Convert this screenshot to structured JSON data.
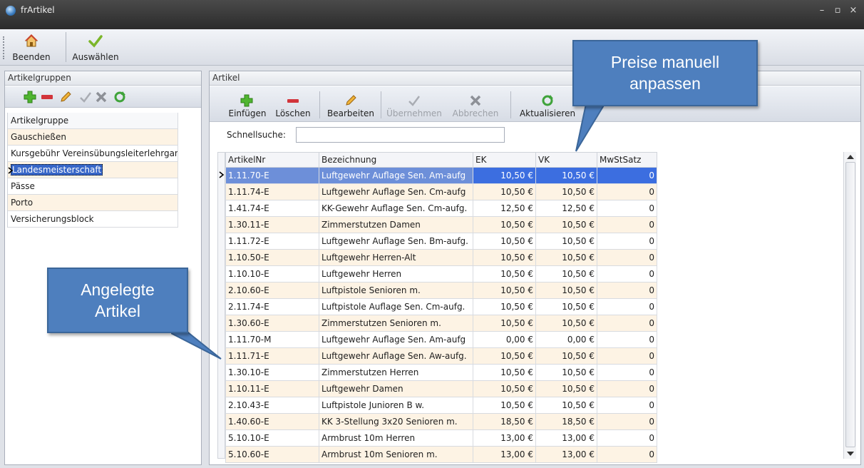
{
  "window": {
    "title": "frArtikel",
    "minimize": "–",
    "maximize": "▫",
    "close": "×"
  },
  "ribbon": {
    "quit_label": "Beenden",
    "select_label": "Auswählen"
  },
  "left_panel": {
    "title": "Artikelgruppen",
    "column_header": "Artikelgruppe",
    "items": [
      "Gauschießen",
      "Kursgebühr Vereinsübungsleiterlehrgang",
      "Landesmeisterschaft",
      "Pässe",
      "Porto",
      "Versicherungsblock"
    ],
    "selected_index": 2
  },
  "right_panel": {
    "title": "Artikel",
    "toolbar": {
      "insert": "Einfügen",
      "delete": "Löschen",
      "edit": "Bearbeiten",
      "apply": "Übernehmen",
      "cancel": "Abbrechen",
      "refresh": "Aktualisieren"
    },
    "search_label": "Schnellsuche:",
    "search_value": "",
    "columns": [
      "ArtikelNr",
      "Bezeichnung",
      "EK",
      "VK",
      "MwStSatz"
    ],
    "rows": [
      [
        "1.11.70-E",
        "Luftgewehr Auflage Sen. Am-aufg",
        "10,50 €",
        "10,50 €",
        "0"
      ],
      [
        "1.11.74-E",
        "Luftgewehr Auflage Sen. Cm-aufg",
        "10,50 €",
        "10,50 €",
        "0"
      ],
      [
        "1.41.74-E",
        "KK-Gewehr Auflage Sen. Cm-aufg.",
        "12,50 €",
        "12,50 €",
        "0"
      ],
      [
        "1.30.11-E",
        "Zimmerstutzen Damen",
        "10,50 €",
        "10,50 €",
        "0"
      ],
      [
        "1.11.72-E",
        "Luftgewehr Auflage Sen. Bm-aufg.",
        "10,50 €",
        "10,50 €",
        "0"
      ],
      [
        "1.10.50-E",
        "Luftgewehr Herren-Alt",
        "10,50 €",
        "10,50 €",
        "0"
      ],
      [
        "1.10.10-E",
        "Luftgewehr Herren",
        "10,50 €",
        "10,50 €",
        "0"
      ],
      [
        "2.10.60-E",
        "Luftpistole Senioren  m.",
        "10,50 €",
        "10,50 €",
        "0"
      ],
      [
        "2.11.74-E",
        "Luftpistole Auflage Sen. Cm-aufg.",
        "10,50 €",
        "10,50 €",
        "0"
      ],
      [
        "1.30.60-E",
        "Zimmerstutzen Senioren  m.",
        "10,50 €",
        "10,50 €",
        "0"
      ],
      [
        "1.11.70-M",
        "Luftgewehr Auflage Sen. Am-aufg",
        "0,00 €",
        "0,00 €",
        "0"
      ],
      [
        "1.11.71-E",
        "Luftgewehr Auflage Sen. Aw-aufg.",
        "10,50 €",
        "10,50 €",
        "0"
      ],
      [
        "1.30.10-E",
        "Zimmerstutzen Herren",
        "10,50 €",
        "10,50 €",
        "0"
      ],
      [
        "1.10.11-E",
        "Luftgewehr Damen",
        "10,50 €",
        "10,50 €",
        "0"
      ],
      [
        "2.10.43-E",
        "Luftpistole Junioren B w.",
        "10,50 €",
        "10,50 €",
        "0"
      ],
      [
        "1.40.60-E",
        "KK 3-Stellung 3x20 Senioren  m.",
        "18,50 €",
        "18,50 €",
        "0"
      ],
      [
        "5.10.10-E",
        "Armbrust 10m Herren",
        "13,00 €",
        "13,00 €",
        "0"
      ],
      [
        "5.10.60-E",
        "Armbrust 10m Senioren  m.",
        "13,00 €",
        "13,00 €",
        "0"
      ]
    ],
    "selected_row": 0
  },
  "callouts": {
    "prices": [
      "Preise manuell",
      "anpassen"
    ],
    "articles": [
      "Angelegte",
      "Artikel"
    ]
  },
  "colors": {
    "accent": "#3c6ee0",
    "row_alt": "#fdf3e4",
    "callout": "#4e7fbe"
  }
}
